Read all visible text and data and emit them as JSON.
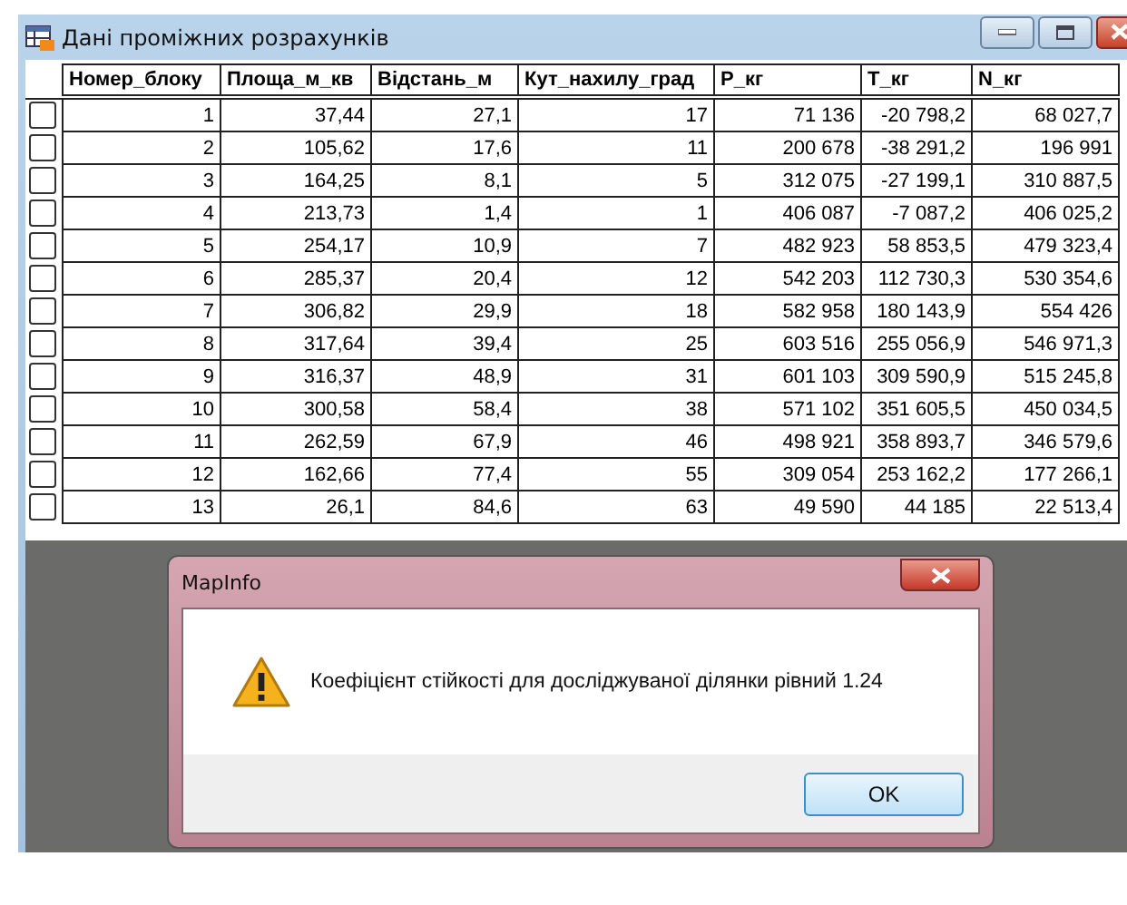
{
  "window": {
    "title": "Дані проміжних розрахунків"
  },
  "table": {
    "columns": [
      "Номер_блоку",
      "Площа_м_кв",
      "Відстань_м",
      "Кут_нахилу_град",
      "P_кг",
      "T_кг",
      "N_кг"
    ],
    "rows": [
      {
        "checked": false,
        "cells": [
          "1",
          "37,44",
          "27,1",
          "17",
          "71 136",
          "-20 798,2",
          "68 027,7"
        ]
      },
      {
        "checked": false,
        "cells": [
          "2",
          "105,62",
          "17,6",
          "11",
          "200 678",
          "-38 291,2",
          "196 991"
        ]
      },
      {
        "checked": false,
        "cells": [
          "3",
          "164,25",
          "8,1",
          "5",
          "312 075",
          "-27 199,1",
          "310 887,5"
        ]
      },
      {
        "checked": false,
        "cells": [
          "4",
          "213,73",
          "1,4",
          "1",
          "406 087",
          "-7 087,2",
          "406 025,2"
        ]
      },
      {
        "checked": false,
        "cells": [
          "5",
          "254,17",
          "10,9",
          "7",
          "482 923",
          "58 853,5",
          "479 323,4"
        ]
      },
      {
        "checked": false,
        "cells": [
          "6",
          "285,37",
          "20,4",
          "12",
          "542 203",
          "112 730,3",
          "530 354,6"
        ]
      },
      {
        "checked": false,
        "cells": [
          "7",
          "306,82",
          "29,9",
          "18",
          "582 958",
          "180 143,9",
          "554 426"
        ]
      },
      {
        "checked": false,
        "cells": [
          "8",
          "317,64",
          "39,4",
          "25",
          "603 516",
          "255 056,9",
          "546 971,3"
        ]
      },
      {
        "checked": false,
        "cells": [
          "9",
          "316,37",
          "48,9",
          "31",
          "601 103",
          "309 590,9",
          "515 245,8"
        ]
      },
      {
        "checked": false,
        "cells": [
          "10",
          "300,58",
          "58,4",
          "38",
          "571 102",
          "351 605,5",
          "450 034,5"
        ]
      },
      {
        "checked": false,
        "cells": [
          "11",
          "262,59",
          "67,9",
          "46",
          "498 921",
          "358 893,7",
          "346 579,6"
        ]
      },
      {
        "checked": false,
        "cells": [
          "12",
          "162,66",
          "77,4",
          "55",
          "309 054",
          "253 162,2",
          "177 266,1"
        ]
      },
      {
        "checked": false,
        "cells": [
          "13",
          "26,1",
          "84,6",
          "63",
          "49 590",
          "44 185",
          "22 513,4"
        ]
      }
    ]
  },
  "dialog": {
    "title": "MapInfo",
    "message": "Коефіцієнт стійкості для досліджуваної ділянки рівний 1.24",
    "buttons": [
      "OK"
    ]
  }
}
